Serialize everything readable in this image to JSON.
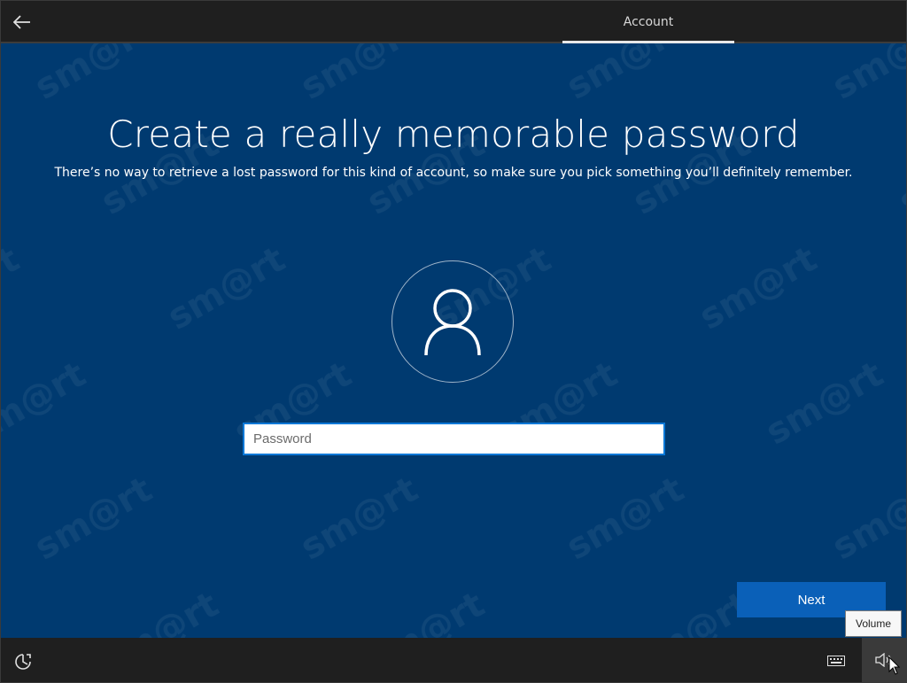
{
  "header": {
    "tab_label": "Account"
  },
  "main": {
    "title": "Create a really memorable password",
    "subtitle": "There’s no way to retrieve a lost password for this kind of account, so make sure you pick something you’ll definitely remember.",
    "password_field": {
      "placeholder": "Password",
      "value": ""
    },
    "next_label": "Next"
  },
  "footer": {
    "tooltip": "Volume"
  },
  "icons": {
    "back": "back-arrow-icon",
    "avatar": "user-icon",
    "ease_of_access": "ease-of-access-icon",
    "keyboard": "keyboard-icon",
    "volume": "volume-icon"
  },
  "colors": {
    "background": "#003a70",
    "accent": "#0a60b8",
    "input_border": "#0a78d7",
    "chrome": "#1f1f1f"
  }
}
